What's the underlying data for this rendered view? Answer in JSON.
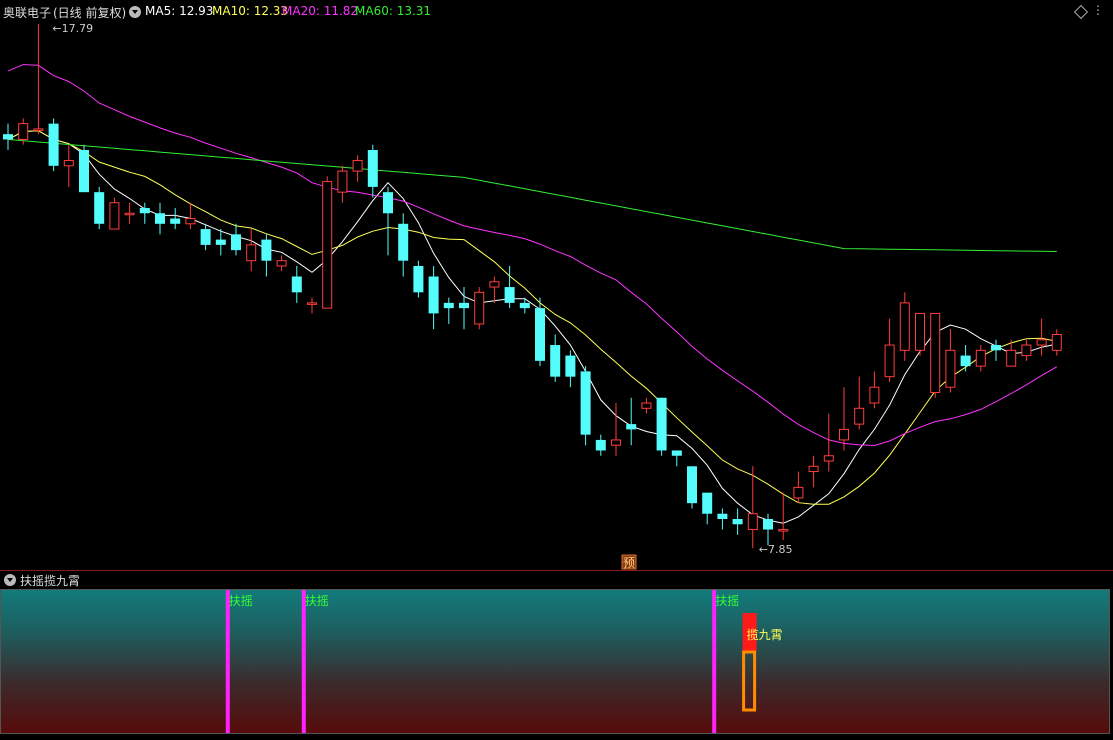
{
  "header": {
    "stock_name": "奥联电子",
    "period": "(日线 前复权)",
    "ma5": {
      "label": "MA5:",
      "value": "12.93",
      "color": "#ffffff"
    },
    "ma10": {
      "label": "MA10:",
      "value": "12.33",
      "color": "#ffff55"
    },
    "ma20": {
      "label": "MA20:",
      "value": "11.82",
      "color": "#ff33ff"
    },
    "ma60": {
      "label": "MA60:",
      "value": "13.31",
      "color": "#33ee33"
    }
  },
  "annotations": {
    "high_label": "17.79",
    "low_label": "7.85",
    "forecast_badge": "预"
  },
  "indicator": {
    "name": "扶摇揽九霄",
    "signal_label": "扶摇",
    "peak_label": "揽九霄",
    "signals": [
      14,
      19,
      46
    ],
    "peak_bar": 48
  },
  "chart_data": {
    "type": "candlestick",
    "price_range": [
      7.85,
      17.79
    ],
    "bar_count": 70,
    "candles": [
      [
        15.7,
        15.6,
        15.9,
        15.4
      ],
      [
        15.6,
        15.9,
        16.0,
        15.5
      ],
      [
        15.8,
        15.8,
        17.79,
        15.7
      ],
      [
        15.9,
        15.1,
        16.0,
        15.0
      ],
      [
        15.1,
        15.2,
        15.5,
        14.7
      ],
      [
        15.4,
        14.6,
        15.5,
        14.6
      ],
      [
        14.6,
        14.0,
        14.7,
        13.9
      ],
      [
        13.9,
        14.4,
        14.5,
        13.9
      ],
      [
        14.2,
        14.2,
        14.4,
        14.0
      ],
      [
        14.3,
        14.2,
        14.4,
        14.0
      ],
      [
        14.2,
        14.0,
        14.4,
        13.8
      ],
      [
        14.1,
        14.0,
        14.3,
        13.9
      ],
      [
        14.0,
        14.1,
        14.4,
        13.9
      ],
      [
        13.9,
        13.6,
        14.0,
        13.5
      ],
      [
        13.7,
        13.6,
        13.9,
        13.4
      ],
      [
        13.8,
        13.5,
        14.0,
        13.4
      ],
      [
        13.3,
        13.6,
        13.9,
        13.1
      ],
      [
        13.7,
        13.3,
        13.8,
        13.0
      ],
      [
        13.2,
        13.3,
        13.4,
        13.1
      ],
      [
        13.0,
        12.7,
        13.2,
        12.5
      ],
      [
        12.5,
        12.5,
        12.6,
        12.3
      ],
      [
        12.4,
        14.8,
        14.9,
        12.4
      ],
      [
        14.6,
        15.0,
        15.1,
        14.4
      ],
      [
        15.0,
        15.2,
        15.3,
        14.8
      ],
      [
        15.4,
        14.7,
        15.5,
        14.5
      ],
      [
        14.6,
        14.2,
        14.7,
        13.4
      ],
      [
        14.0,
        13.3,
        14.2,
        13.0
      ],
      [
        13.2,
        12.7,
        13.3,
        12.6
      ],
      [
        13.0,
        12.3,
        13.2,
        12.0
      ],
      [
        12.5,
        12.4,
        12.6,
        12.1
      ],
      [
        12.5,
        12.4,
        12.8,
        12.0
      ],
      [
        12.1,
        12.7,
        12.8,
        12.0
      ],
      [
        12.8,
        12.9,
        13.0,
        12.5
      ],
      [
        12.8,
        12.5,
        13.2,
        12.4
      ],
      [
        12.5,
        12.4,
        12.6,
        12.3
      ],
      [
        12.4,
        11.4,
        12.6,
        11.3
      ],
      [
        11.7,
        11.1,
        11.9,
        11.0
      ],
      [
        11.5,
        11.1,
        11.6,
        10.9
      ],
      [
        11.2,
        10.0,
        11.3,
        9.8
      ],
      [
        9.9,
        9.7,
        10.0,
        9.6
      ],
      [
        9.8,
        9.9,
        10.6,
        9.6
      ],
      [
        10.2,
        10.1,
        10.7,
        9.8
      ],
      [
        10.5,
        10.6,
        10.7,
        10.4
      ],
      [
        10.7,
        9.7,
        10.7,
        9.6
      ],
      [
        9.7,
        9.6,
        9.7,
        9.4
      ],
      [
        9.4,
        8.7,
        9.4,
        8.6
      ],
      [
        8.9,
        8.5,
        8.9,
        8.3
      ],
      [
        8.5,
        8.4,
        8.6,
        8.2
      ],
      [
        8.4,
        8.3,
        8.6,
        8.1
      ],
      [
        8.2,
        8.5,
        9.4,
        7.85
      ],
      [
        8.4,
        8.2,
        8.5,
        7.9
      ],
      [
        8.2,
        8.2,
        8.9,
        8.0
      ],
      [
        8.8,
        9.0,
        9.3,
        8.7
      ],
      [
        9.3,
        9.4,
        9.6,
        9.0
      ],
      [
        9.5,
        9.6,
        10.4,
        9.3
      ],
      [
        9.9,
        10.1,
        10.9,
        9.7
      ],
      [
        10.2,
        10.5,
        11.1,
        10.1
      ],
      [
        10.6,
        10.9,
        11.2,
        10.5
      ],
      [
        11.1,
        11.7,
        12.2,
        11.0
      ],
      [
        11.6,
        12.5,
        12.7,
        11.4
      ],
      [
        11.6,
        12.3,
        12.3,
        11.5
      ],
      [
        10.8,
        12.3,
        12.3,
        10.7
      ],
      [
        10.9,
        11.6,
        12.0,
        10.8
      ],
      [
        11.5,
        11.3,
        11.7,
        11.2
      ],
      [
        11.3,
        11.6,
        11.7,
        11.2
      ],
      [
        11.7,
        11.6,
        11.8,
        11.4
      ],
      [
        11.3,
        11.6,
        11.8,
        11.3
      ],
      [
        11.5,
        11.7,
        11.8,
        11.4
      ],
      [
        11.7,
        11.8,
        12.2,
        11.5
      ],
      [
        11.6,
        11.9,
        12.0,
        11.5
      ]
    ],
    "series": [
      {
        "name": "MA5",
        "color": "#ffffff",
        "values": []
      },
      {
        "name": "MA10",
        "color": "#ffff55",
        "values": []
      },
      {
        "name": "MA20",
        "color": "#ff33ff",
        "values": []
      },
      {
        "name": "MA60",
        "color": "#33ee33",
        "values": []
      }
    ]
  }
}
